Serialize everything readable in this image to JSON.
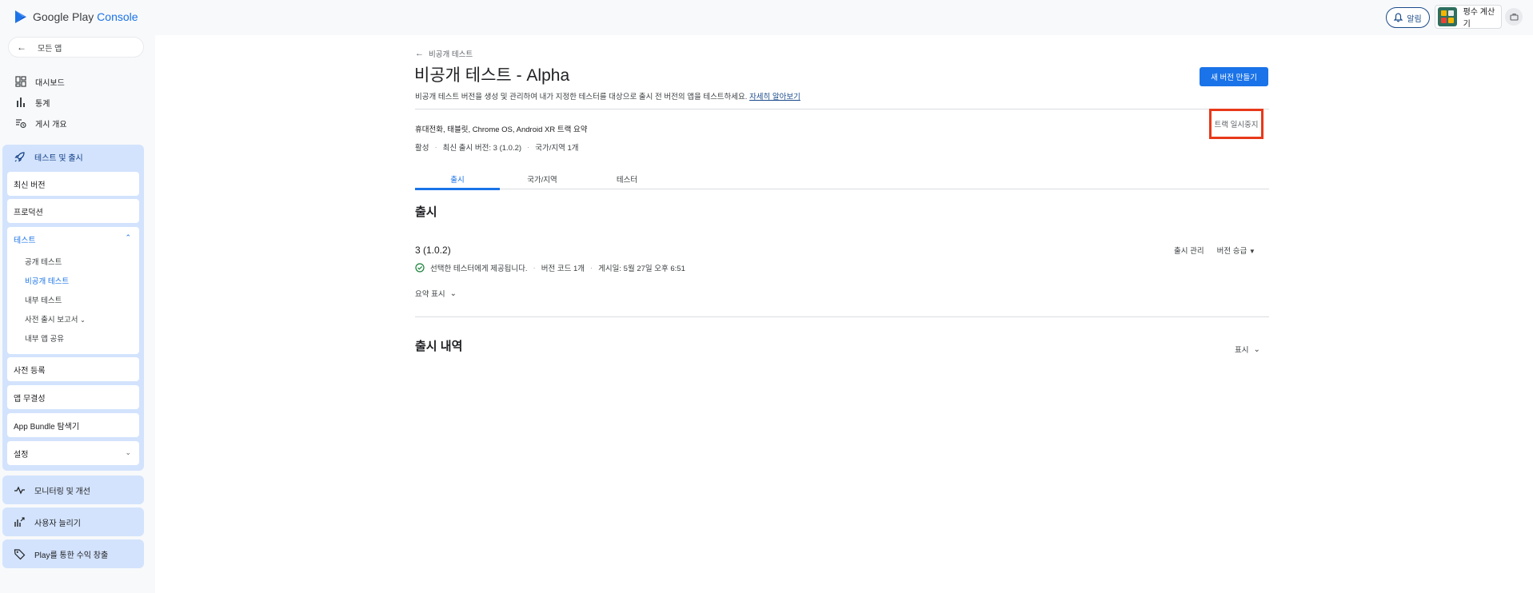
{
  "topbar": {
    "logo_text": "Google Play",
    "logo_accent": "Console",
    "notify_label": "알림",
    "app_name": "평수 계산기"
  },
  "sidebar": {
    "all_apps": "모든 앱",
    "items": [
      {
        "label": "대시보드",
        "icon": "dashboard-icon"
      },
      {
        "label": "통계",
        "icon": "bar-chart-icon"
      },
      {
        "label": "게시 개요",
        "icon": "publishing-overview-icon"
      }
    ],
    "release_group": {
      "label": "테스트 및 출시",
      "cards": {
        "latest": "최신 버전",
        "production": "프로덕션",
        "preregister": "사전 등록",
        "integrity": "앱 무결성",
        "bundle_explorer": "App Bundle 탐색기",
        "settings": "설정"
      },
      "testing": {
        "label": "테스트",
        "links": [
          "공개 테스트",
          "비공개 테스트",
          "내부 테스트",
          "사전 출시 보고서",
          "내부 앱 공유"
        ]
      }
    },
    "lower_groups": [
      {
        "label": "모니터링 및 개선",
        "icon": "monitor-icon"
      },
      {
        "label": "사용자 늘리기",
        "icon": "grow-users-icon"
      },
      {
        "label": "Play를 통한 수익 창출",
        "icon": "tag-icon"
      }
    ]
  },
  "main": {
    "back_label": "비공개 테스트",
    "title": "비공개 테스트 - Alpha",
    "description": "비공개 테스트 버전을 생성 및 관리하여 내가 지정한 테스터를 대상으로 출시 전 버전의 앱을 테스트하세요.",
    "learn_more": "자세히 알아보기",
    "new_version_button": "새 버전 만들기",
    "track_summary": "휴대전화, 태블릿, Chrome OS, Android XR 트랙 요약",
    "pause_track": "트랙 일시중지",
    "status": {
      "active": "활성",
      "latest_release": "최신 출시 버전: 3 (1.0.2)",
      "countries": "국가/지역 1개"
    },
    "tabs": [
      "출시",
      "국가/지역",
      "테스터"
    ],
    "section_title": "출시",
    "release": {
      "name": "3 (1.0.2)",
      "manage": "출시 관리",
      "promote": "버전 승급",
      "available_to": "선택한 테스터에게 제공됩니다.",
      "version_code": "버전 코드 1개",
      "published": "게시일: 5월 27일 오후 6:51",
      "show_summary": "요약 표시"
    },
    "history_title": "출시 내역",
    "history_show": "표시"
  },
  "colors": {
    "accent": "#1a73e8",
    "nav_group_bg": "#d3e3fd",
    "highlight_border": "#e8391a",
    "success": "#188038"
  }
}
